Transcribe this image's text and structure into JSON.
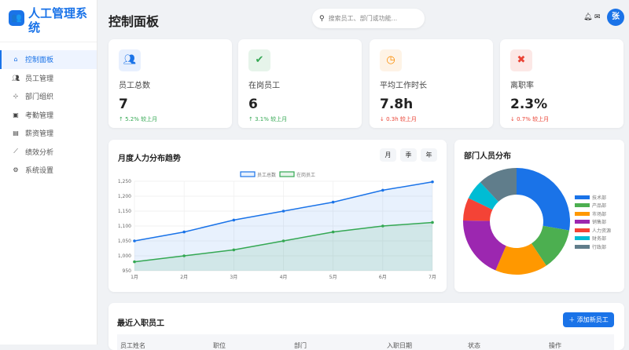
{
  "app": {
    "title": "人工管理系统",
    "logo_icon": "people-gear-icon"
  },
  "sidebar": {
    "items": [
      {
        "label": "控制面板",
        "icon": "home-icon",
        "active": true
      },
      {
        "label": "员工管理",
        "icon": "users-icon"
      },
      {
        "label": "部门组织",
        "icon": "sitemap-icon"
      },
      {
        "label": "考勤管理",
        "icon": "calendar-check-icon"
      },
      {
        "label": "薪资管理",
        "icon": "invoice-icon"
      },
      {
        "label": "绩效分析",
        "icon": "chart-line-icon"
      },
      {
        "label": "系统设置",
        "icon": "gear-icon"
      }
    ]
  },
  "header": {
    "title": "控制面板",
    "search_placeholder": "搜索员工、部门或功能...",
    "avatar": "张"
  },
  "stats": [
    {
      "label": "员工总数",
      "value": "7",
      "change": "5.2%",
      "suffix": "较上月",
      "dir": "up",
      "color": "#1a73e8",
      "bg": "#e8f0fe"
    },
    {
      "label": "在岗员工",
      "value": "6",
      "change": "3.1%",
      "suffix": "较上月",
      "dir": "up",
      "color": "#34a853",
      "bg": "#e6f4ea"
    },
    {
      "label": "平均工作时长",
      "value": "7.8h",
      "change": "0.3h",
      "suffix": "较上月",
      "dir": "down",
      "color": "#fb8c00",
      "bg": "#fef3e6"
    },
    {
      "label": "离职率",
      "value": "2.3%",
      "change": "0.7%",
      "suffix": "较上月",
      "dir": "down",
      "color": "#ea4335",
      "bg": "#fce8e6"
    }
  ],
  "trend": {
    "title": "月度人力分布趋势",
    "periods": [
      "月",
      "季",
      "年"
    ]
  },
  "pie": {
    "title": "部门人员分布"
  },
  "recent": {
    "title": "最近入职员工",
    "add_button": "添加新员工",
    "columns": [
      "员工姓名",
      "职位",
      "部门",
      "入职日期",
      "状态",
      "操作"
    ]
  },
  "chart_data": [
    {
      "type": "line",
      "title": "月度人力分布趋势",
      "categories": [
        "1月",
        "2月",
        "3月",
        "4月",
        "5月",
        "6月",
        "7月"
      ],
      "series": [
        {
          "name": "员工总数",
          "values": [
            1050,
            1080,
            1120,
            1150,
            1180,
            1220,
            1248
          ],
          "color": "#1a73e8"
        },
        {
          "name": "在岗员工",
          "values": [
            980,
            1000,
            1020,
            1050,
            1080,
            1100,
            1112
          ],
          "color": "#34a853"
        }
      ],
      "ylim": [
        950,
        1250
      ],
      "yticks": [
        "950",
        "1,000",
        "1,050",
        "1,100",
        "1,150",
        "1,200",
        "1,250"
      ],
      "legend": "top"
    },
    {
      "type": "pie",
      "title": "部门人员分布",
      "categories": [
        "技术部",
        "产品部",
        "市场部",
        "销售部",
        "人力资源",
        "财务部",
        "行政部"
      ],
      "values": [
        28,
        13,
        16,
        19,
        7,
        6,
        12
      ],
      "colors": [
        "#1a73e8",
        "#4caf50",
        "#ff9800",
        "#9c27b0",
        "#f44336",
        "#00bcd4",
        "#607d8b"
      ],
      "legend": "right"
    }
  ]
}
